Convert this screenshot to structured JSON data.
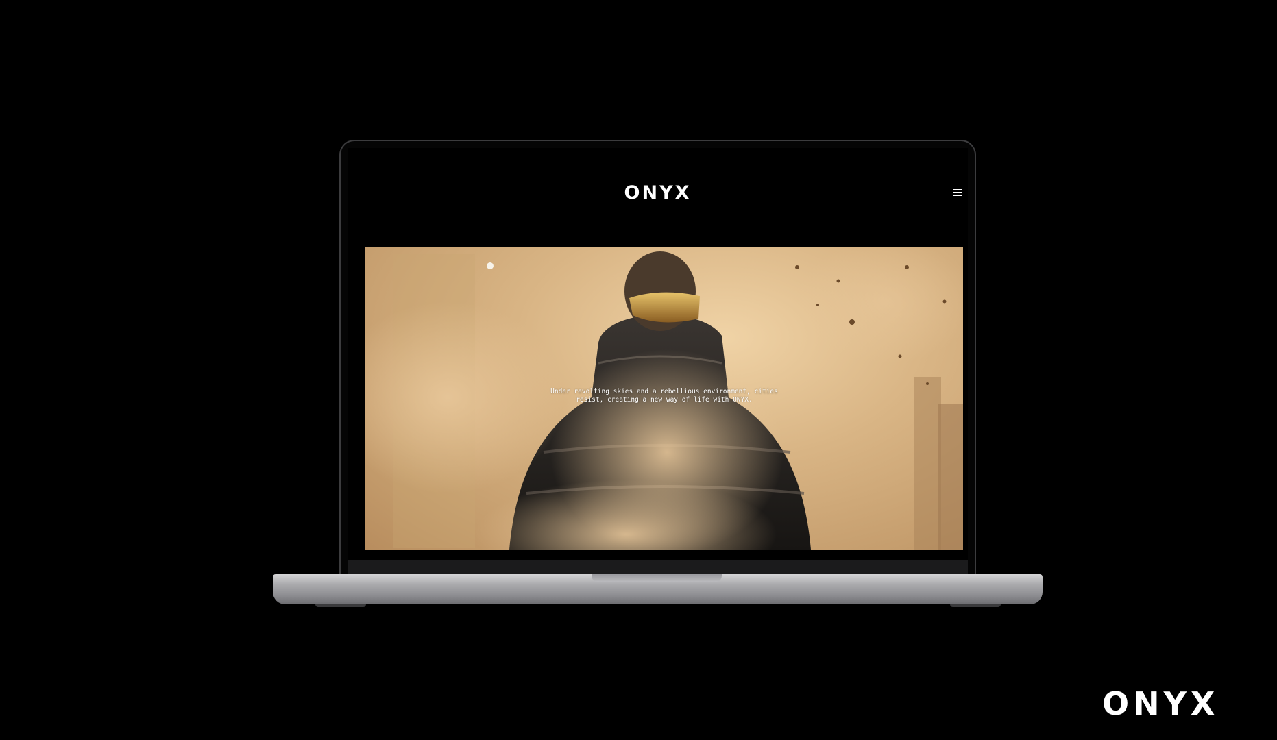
{
  "site": {
    "logo_text": "ONYX",
    "menu_icon": "hamburger-menu-icon"
  },
  "hero": {
    "caption_line1": "Under revolting skies and a rebellious environment, cities",
    "caption_line2": "resist, creating a new way of life with ONYX.",
    "image": "person-in-puffer-jacket-with-gold-visor-in-dust"
  },
  "brand": {
    "corner_logo_text": "ONYX"
  },
  "colors": {
    "background": "#000000",
    "hero_tone": "#d9b585",
    "text": "#ffffff"
  }
}
